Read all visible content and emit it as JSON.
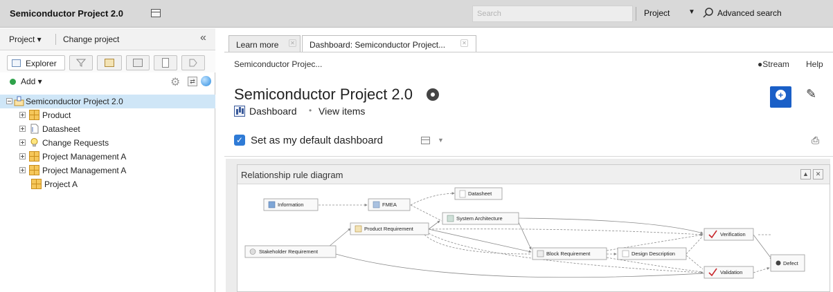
{
  "app": {
    "title": "Semiconductor Project 2.0"
  },
  "search": {
    "placeholder": "Search",
    "scope": "Project",
    "advanced_label": "Advanced search"
  },
  "left_panel": {
    "project_menu": "Project ▾",
    "change_project": "Change project",
    "collapse": "«",
    "tabs": {
      "explorer": "Explorer"
    },
    "add_label": "Add ▾",
    "tree": [
      {
        "label": "Semiconductor Project 2.0",
        "icon": "project-icon",
        "selected": true
      },
      {
        "label": "Product",
        "icon": "grid-icon"
      },
      {
        "label": "Datasheet",
        "icon": "document-icon"
      },
      {
        "label": "Change Requests",
        "icon": "lightbulb-icon"
      },
      {
        "label": "Project Management A",
        "icon": "grid-icon"
      },
      {
        "label": "Project Management A",
        "icon": "grid-icon"
      },
      {
        "label": "Project A",
        "icon": "grid-icon"
      }
    ]
  },
  "main": {
    "tabs": [
      {
        "label": "Learn more"
      },
      {
        "label": "Dashboard: Semiconductor Project..."
      }
    ],
    "breadcrumb": "Semiconductor Projec...",
    "stream": "Stream",
    "help": "Help",
    "title": "Semiconductor Project 2.0",
    "views": {
      "dashboard": "Dashboard",
      "sep": "•",
      "items": "View items"
    },
    "default_dashboard": {
      "label": "Set as my default dashboard",
      "checked": true
    }
  },
  "widget": {
    "title": "Relationship rule diagram",
    "nodes": [
      {
        "id": "information",
        "label": "Information"
      },
      {
        "id": "fmea",
        "label": "FMEA"
      },
      {
        "id": "datasheet",
        "label": "Datasheet"
      },
      {
        "id": "system_architecture",
        "label": "System Architecture"
      },
      {
        "id": "product_requirement",
        "label": "Product Requirement"
      },
      {
        "id": "verification",
        "label": "Verification"
      },
      {
        "id": "stakeholder_requirement",
        "label": "Stakeholder Requirement"
      },
      {
        "id": "block_requirement",
        "label": "Block Requirement"
      },
      {
        "id": "design_description",
        "label": "Design Description"
      },
      {
        "id": "defect",
        "label": "Defect"
      },
      {
        "id": "validation",
        "label": "Validation"
      }
    ]
  },
  "colors": {
    "accent": "#1a5fc7",
    "selection": "#cfe6f7",
    "add_green": "#2fa24a"
  }
}
